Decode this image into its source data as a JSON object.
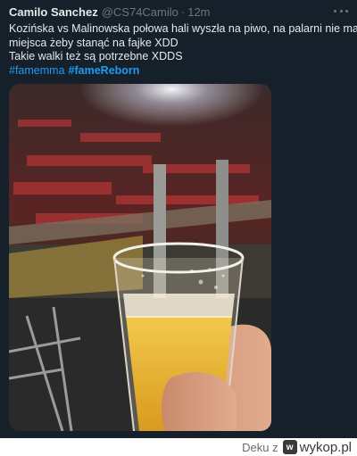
{
  "tweet": {
    "author_name": "Camilo Sanchez",
    "handle": "@CS74Camilo",
    "separator": "·",
    "time": "12m",
    "text_lines": [
      "Kozińska vs Malinowska połowa hali wyszła na piwo, na palarni nie ma",
      "miejsca żeby stanąć na fajke XDD",
      "Takie walki też są potrzebne XDDS"
    ],
    "hashtags": [
      "#famemma",
      "#fameReborn"
    ],
    "more_icon": "ellipsis-icon"
  },
  "footer": {
    "credit": "Deku z",
    "site": "wykop.pl",
    "logo_icon": "wykop-logo-icon"
  },
  "colors": {
    "background": "#15202b",
    "text": "#e7e9ea",
    "muted": "#71767b",
    "link": "#1d9bf0"
  }
}
